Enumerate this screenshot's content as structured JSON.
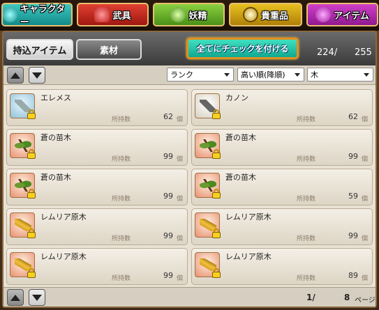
{
  "tabs": [
    {
      "label": "キャラクター",
      "icon": "character-icon"
    },
    {
      "label": "武具",
      "icon": "weapon-icon"
    },
    {
      "label": "妖精",
      "icon": "fairy-icon"
    },
    {
      "label": "貴重品",
      "icon": "valuables-icon"
    },
    {
      "label": "アイテム",
      "icon": "item-icon"
    }
  ],
  "subtabs": {
    "carry": "持込アイテム",
    "material": "素材"
  },
  "check_all_button": "全てにチェックを付ける",
  "count": {
    "current": "224/",
    "max": "255"
  },
  "sort": {
    "field": "ランク",
    "order": "高い順(降順)",
    "filter": "木"
  },
  "items": [
    {
      "name": "エレメス",
      "own_label": "所持数",
      "count": "62",
      "unit": "個",
      "icon": "elemes-icon"
    },
    {
      "name": "カノン",
      "own_label": "所持数",
      "count": "62",
      "unit": "個",
      "icon": "carnon-icon"
    },
    {
      "name": "蒼の苗木",
      "own_label": "所持数",
      "count": "99",
      "unit": "個",
      "icon": "sapling-icon"
    },
    {
      "name": "蒼の苗木",
      "own_label": "所持数",
      "count": "99",
      "unit": "個",
      "icon": "sapling-icon"
    },
    {
      "name": "蒼の苗木",
      "own_label": "所持数",
      "count": "99",
      "unit": "個",
      "icon": "sapling-icon"
    },
    {
      "name": "蒼の苗木",
      "own_label": "所持数",
      "count": "59",
      "unit": "個",
      "icon": "sapling-icon"
    },
    {
      "name": "レムリア原木",
      "own_label": "所持数",
      "count": "99",
      "unit": "個",
      "icon": "log-icon"
    },
    {
      "name": "レムリア原木",
      "own_label": "所持数",
      "count": "99",
      "unit": "個",
      "icon": "log-icon"
    },
    {
      "name": "レムリア原木",
      "own_label": "所持数",
      "count": "99",
      "unit": "個",
      "icon": "log-icon"
    },
    {
      "name": "レムリア原木",
      "own_label": "所持数",
      "count": "89",
      "unit": "個",
      "icon": "log-icon"
    }
  ],
  "pagination": {
    "current": "1/",
    "total": "8",
    "unit": "ページ"
  }
}
